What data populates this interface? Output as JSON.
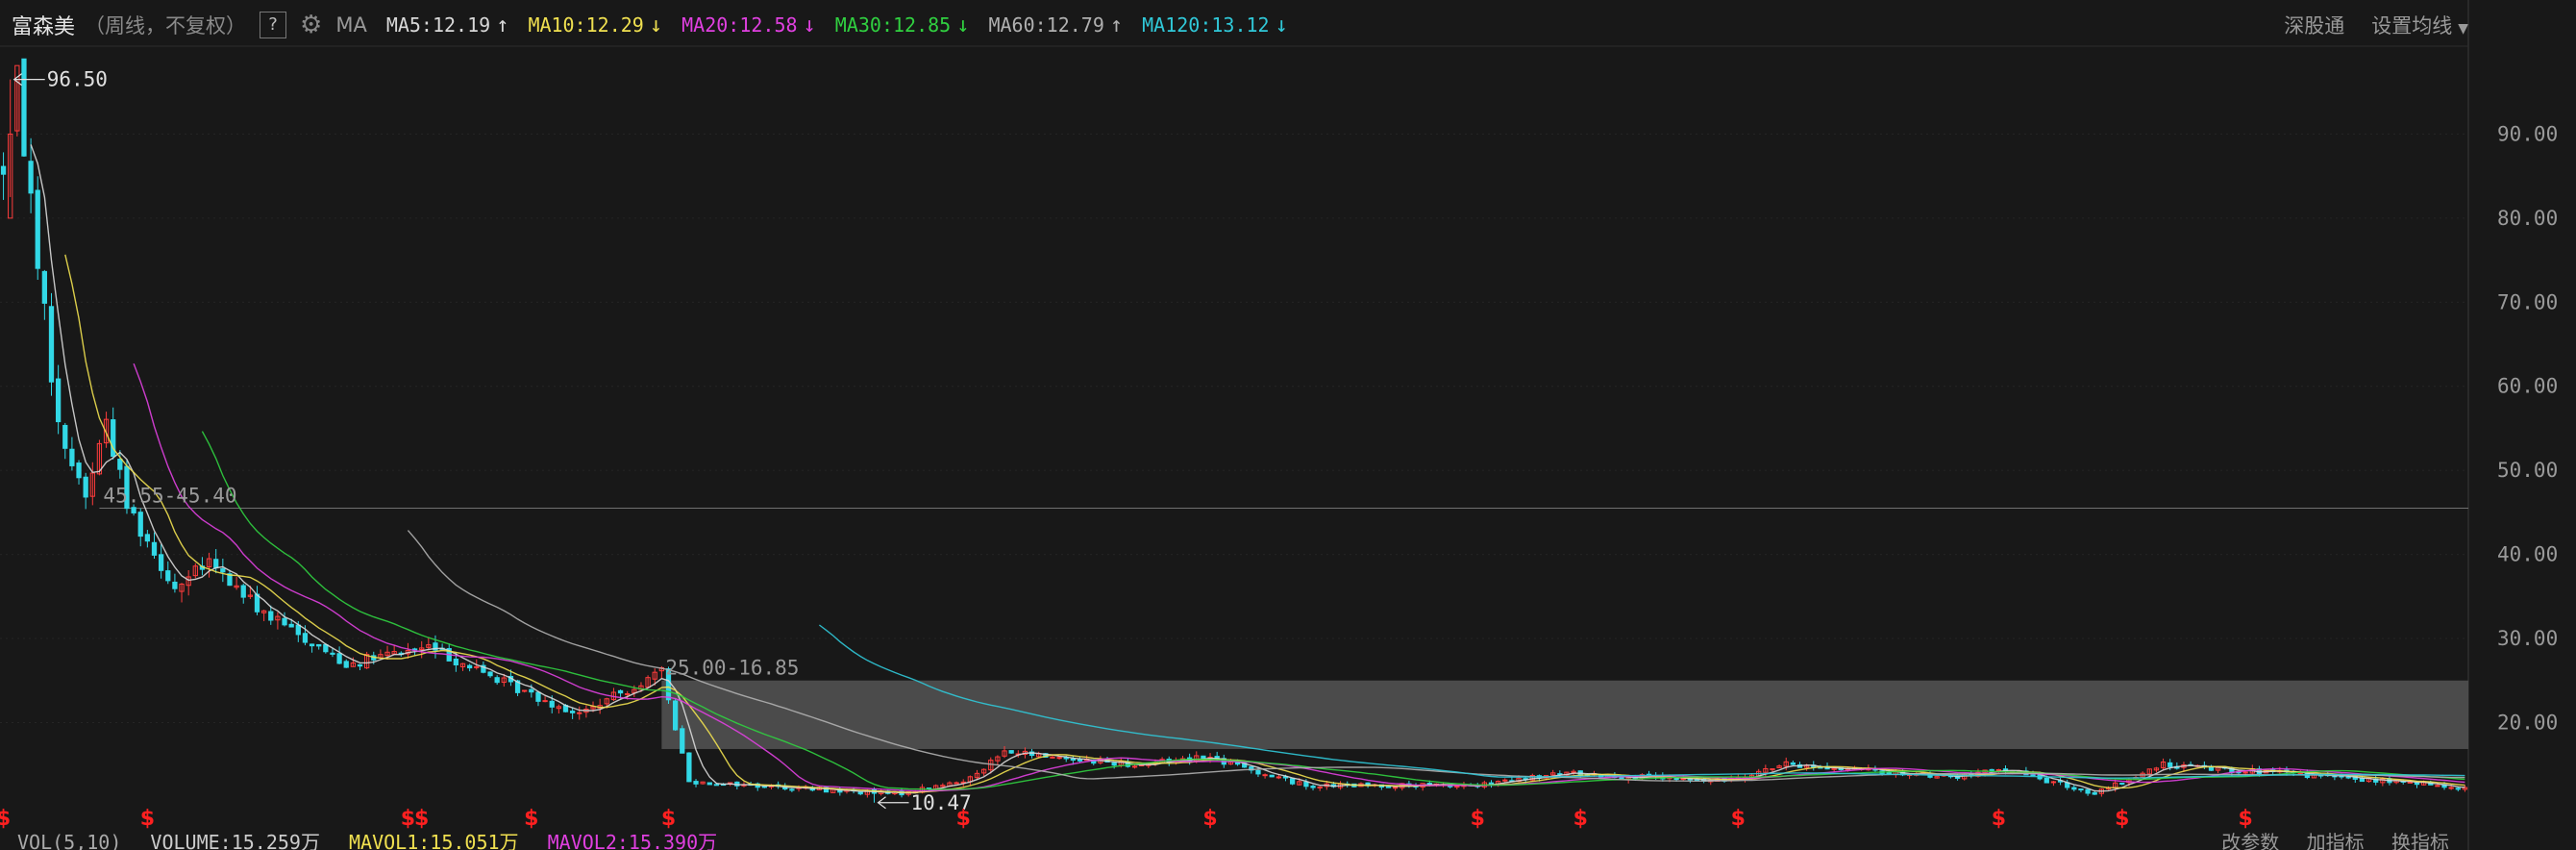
{
  "header": {
    "stock_name": "富森美",
    "period": "（周线，不复权）",
    "help": "?",
    "indicator": "MA",
    "ma_values": [
      {
        "text": "MA5:12.19",
        "arrow": "↑",
        "color": "#d8d8d8"
      },
      {
        "text": "MA10:12.29",
        "arrow": "↓",
        "color": "#f0e050"
      },
      {
        "text": "MA20:12.58",
        "arrow": "↓",
        "color": "#e040e0"
      },
      {
        "text": "MA30:12.85",
        "arrow": "↓",
        "color": "#30d040"
      },
      {
        "text": "MA60:12.79",
        "arrow": "↑",
        "color": "#b0b0b0"
      },
      {
        "text": "MA120:13.12",
        "arrow": "↓",
        "color": "#30c8d8"
      }
    ],
    "shen_gu_tong": "深股通",
    "set_ma": "设置均线"
  },
  "footer": {
    "vol_label": "VOL(5,10)",
    "volume": "VOLUME:15.259万",
    "mavol1": "MAVOL1:15.051万",
    "mavol2": "MAVOL2:15.390万",
    "right_items": [
      "改参数",
      "加指标",
      "换指标"
    ]
  },
  "chart_data": {
    "type": "candlestick",
    "y_ticks": [
      "90.00",
      "80.00",
      "70.00",
      "60.00",
      "50.00",
      "40.00",
      "30.00",
      "20.00"
    ],
    "y_tick_values": [
      90,
      80,
      70,
      60,
      50,
      40,
      30,
      20
    ],
    "ylim": [
      8.5,
      100
    ],
    "high_label": "96.50",
    "high_value": 96.5,
    "low_label": "10.47",
    "low_value": 10.47,
    "range_labels": [
      {
        "text": "45.55-45.40",
        "value": 45.5
      },
      {
        "text": "25.00-16.85",
        "from": 25.0,
        "to": 16.85
      }
    ],
    "n_bars": 360,
    "signal_glyph": "$",
    "signal_bars": [
      0,
      21,
      59,
      61,
      77,
      97,
      140,
      176,
      215,
      230,
      253,
      291,
      309,
      327
    ],
    "colors": {
      "up": "#ff3c3c",
      "down": "#32d8e6",
      "band": "#4e4e4e",
      "level_line": "#707070"
    },
    "price_segments": [
      {
        "from": 0,
        "to": 2,
        "price": [
          86,
          96
        ]
      },
      {
        "from": 2,
        "to": 8,
        "price": [
          96,
          55
        ]
      },
      {
        "from": 8,
        "to": 12,
        "price": [
          55,
          47
        ]
      },
      {
        "from": 12,
        "to": 15,
        "price": [
          47,
          56
        ]
      },
      {
        "from": 15,
        "to": 18,
        "price": [
          56,
          46
        ]
      },
      {
        "from": 18,
        "to": 25,
        "price": [
          46,
          36
        ]
      },
      {
        "from": 25,
        "to": 30,
        "price": [
          36,
          39
        ]
      },
      {
        "from": 30,
        "to": 38,
        "price": [
          39,
          33
        ]
      },
      {
        "from": 38,
        "to": 50,
        "price": [
          33,
          27
        ]
      },
      {
        "from": 50,
        "to": 62,
        "price": [
          27,
          29
        ]
      },
      {
        "from": 62,
        "to": 75,
        "price": [
          29,
          24
        ]
      },
      {
        "from": 75,
        "to": 84,
        "price": [
          24,
          21
        ]
      },
      {
        "from": 84,
        "to": 96,
        "price": [
          21,
          26
        ]
      },
      {
        "from": 96,
        "to": 100,
        "price": [
          26,
          13
        ]
      },
      {
        "from": 100,
        "to": 130,
        "price": [
          13,
          11.5
        ]
      },
      {
        "from": 130,
        "to": 140,
        "price": [
          11.5,
          13
        ]
      },
      {
        "from": 140,
        "to": 146,
        "price": [
          13,
          16.5
        ]
      },
      {
        "from": 146,
        "to": 165,
        "price": [
          16.5,
          15
        ]
      },
      {
        "from": 165,
        "to": 175,
        "price": [
          15,
          16
        ]
      },
      {
        "from": 175,
        "to": 190,
        "price": [
          16,
          12.5
        ]
      },
      {
        "from": 190,
        "to": 215,
        "price": [
          12.5,
          12.5
        ]
      },
      {
        "from": 215,
        "to": 228,
        "price": [
          12.5,
          14
        ]
      },
      {
        "from": 228,
        "to": 250,
        "price": [
          14,
          13
        ]
      },
      {
        "from": 250,
        "to": 260,
        "price": [
          13,
          15
        ]
      },
      {
        "from": 260,
        "to": 285,
        "price": [
          15,
          13.5
        ]
      },
      {
        "from": 285,
        "to": 292,
        "price": [
          13.5,
          14.5
        ]
      },
      {
        "from": 292,
        "to": 305,
        "price": [
          14.5,
          11.5
        ]
      },
      {
        "from": 305,
        "to": 315,
        "price": [
          11.5,
          15
        ]
      },
      {
        "from": 315,
        "to": 340,
        "price": [
          15,
          13.5
        ]
      },
      {
        "from": 340,
        "to": 360,
        "price": [
          13.5,
          12.2
        ]
      }
    ],
    "moving_averages": [
      {
        "name": "MA5",
        "period": 5,
        "color": "#d8d8d8"
      },
      {
        "name": "MA10",
        "period": 10,
        "color": "#f0e050"
      },
      {
        "name": "MA20",
        "period": 20,
        "color": "#e040e0"
      },
      {
        "name": "MA30",
        "period": 30,
        "color": "#30d040"
      },
      {
        "name": "MA60",
        "period": 60,
        "color": "#b0b0b0"
      },
      {
        "name": "MA120",
        "period": 120,
        "color": "#30c8d8"
      }
    ]
  }
}
